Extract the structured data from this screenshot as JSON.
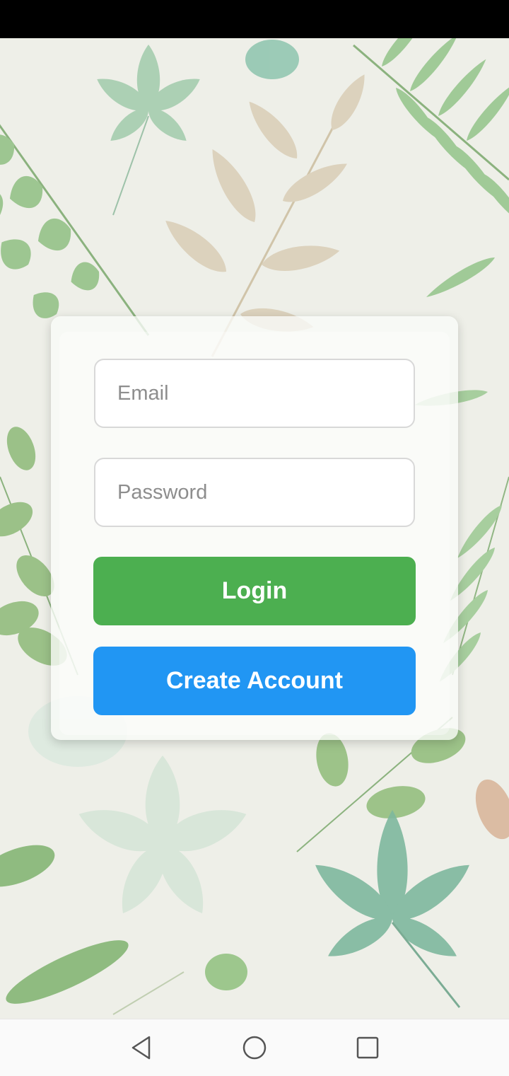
{
  "login_form": {
    "email_placeholder": "Email",
    "email_value": "",
    "password_placeholder": "Password",
    "password_value": "",
    "login_label": "Login",
    "create_account_label": "Create Account"
  },
  "colors": {
    "login_button": "#4caf50",
    "create_account_button": "#2196f3",
    "background": "#eeefe8"
  },
  "icons": {
    "nav_back": "back-triangle-icon",
    "nav_home": "home-circle-icon",
    "nav_recents": "recents-square-icon"
  }
}
